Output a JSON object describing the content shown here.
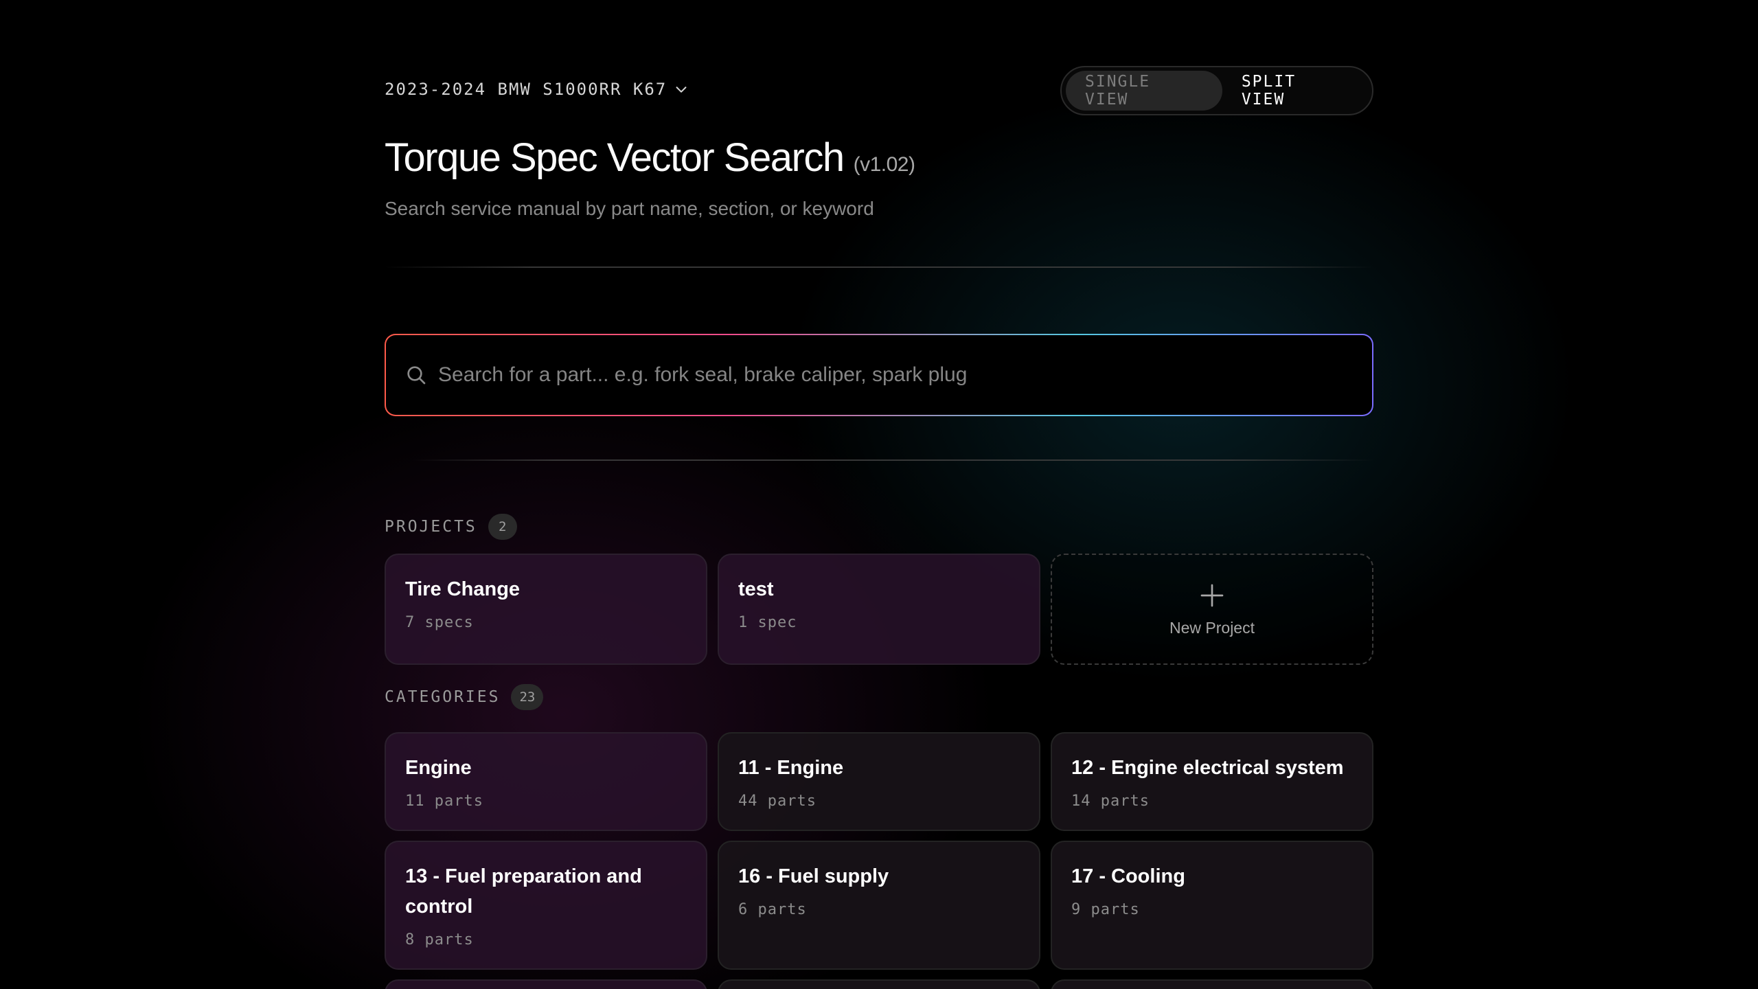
{
  "header": {
    "vehicle": "2023-2024 BMW S1000RR K67",
    "view_toggle": {
      "single": "SINGLE VIEW",
      "split": "SPLIT VIEW",
      "active": "split"
    },
    "title": "Torque Spec Vector Search",
    "version": "(v1.02)",
    "subtitle": "Search service manual by part name, section, or keyword"
  },
  "search": {
    "placeholder": "Search for a part... e.g. fork seal, brake caliper, spark plug",
    "value": ""
  },
  "projects": {
    "label": "PROJECTS",
    "count": "2",
    "items": [
      {
        "title": "Tire Change",
        "sub": "7 specs"
      },
      {
        "title": "test",
        "sub": "1 spec"
      }
    ],
    "new_label": "New Project"
  },
  "categories": {
    "label": "CATEGORIES",
    "count": "23",
    "items": [
      {
        "title": "Engine",
        "sub": "11 parts"
      },
      {
        "title": "11 - Engine",
        "sub": "44 parts"
      },
      {
        "title": "12 - Engine electrical system",
        "sub": "14 parts"
      },
      {
        "title": "13 - Fuel preparation and control",
        "sub": "8 parts"
      },
      {
        "title": "16 - Fuel supply",
        "sub": "6 parts"
      },
      {
        "title": "17 - Cooling",
        "sub": "9 parts"
      }
    ]
  },
  "colors": {
    "accent_gradient": [
      "#ff5a4a",
      "#ee4c8c",
      "#55c7e0",
      "#7a6cff"
    ],
    "background": "#000000"
  }
}
